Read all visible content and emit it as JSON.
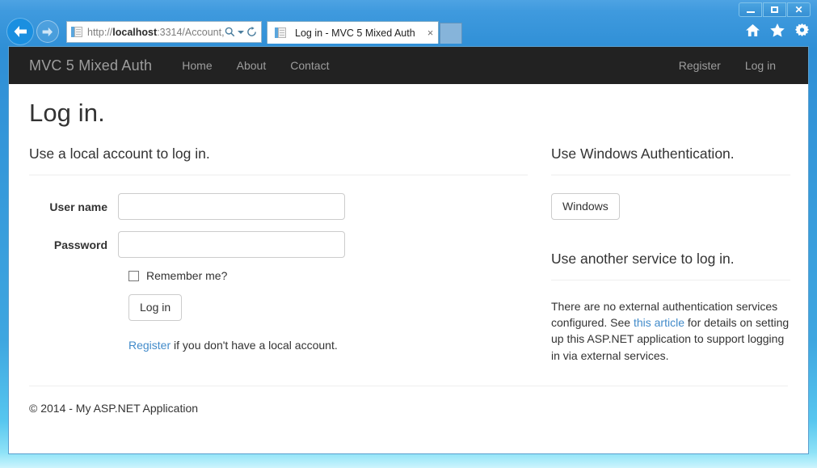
{
  "browser": {
    "url_prefix": "http://",
    "url_bold": "localhost",
    "url_suffix": ":3314/Account,",
    "tab_title": "Log in - MVC 5 Mixed Auth",
    "tab_close_label": "×",
    "search_icon": "search-icon",
    "caret_icon": "chevron-down-icon",
    "refresh_icon": "refresh-icon",
    "back_icon": "back-arrow-icon",
    "forward_icon": "forward-arrow-icon",
    "new_tab_label": "",
    "tools": {
      "home": "home-icon",
      "favorites": "star-icon",
      "settings": "gear-icon"
    },
    "window_controls": {
      "minimize": "minimize-button",
      "maximize": "maximize-button",
      "close": "close-button",
      "close_glyph": "✕"
    }
  },
  "site": {
    "brand": "MVC 5 Mixed Auth",
    "nav_left": [
      {
        "label": "Home"
      },
      {
        "label": "About"
      },
      {
        "label": "Contact"
      }
    ],
    "nav_right": [
      {
        "label": "Register"
      },
      {
        "label": "Log in"
      }
    ]
  },
  "page": {
    "title": "Log in.",
    "local": {
      "heading": "Use a local account to log in.",
      "username_label": "User name",
      "username_value": "",
      "username_placeholder": "",
      "password_label": "Password",
      "password_value": "",
      "password_placeholder": "",
      "remember_label": "Remember me?",
      "remember_checked": false,
      "submit_label": "Log in",
      "register_link": "Register",
      "register_rest": " if you don't have a local account."
    },
    "windows_auth": {
      "heading": "Use Windows Authentication.",
      "button_label": "Windows"
    },
    "external": {
      "heading": "Use another service to log in.",
      "text_before": "There are no external authentication services configured. See ",
      "link": "this article",
      "text_after": " for details on setting up this ASP.NET application to support logging in via external services."
    },
    "footer": "© 2014 - My ASP.NET Application"
  },
  "colors": {
    "navbar_bg": "#222222",
    "nav_link": "#9d9d9d",
    "link": "#428bca",
    "chrome_blue": "#2f8fd6"
  }
}
